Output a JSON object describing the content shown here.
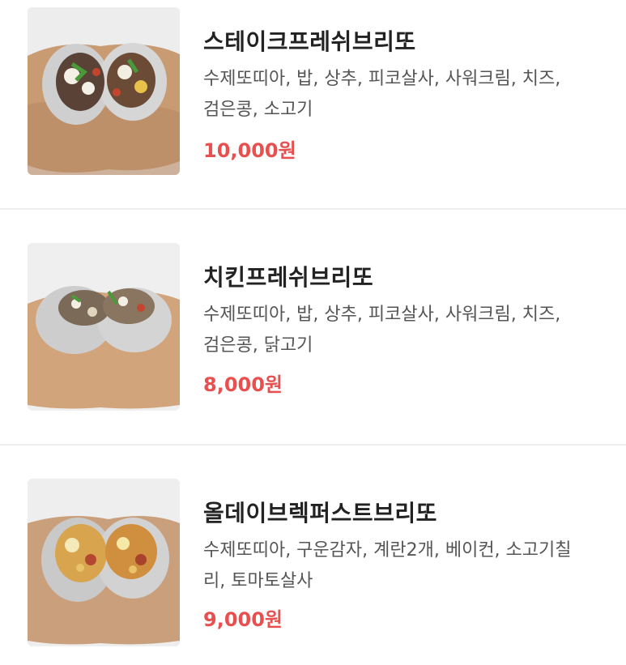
{
  "items": [
    {
      "name": "스테이크프레쉬브리또",
      "desc_line1": "수제또띠아, 밥, 상추, 피코살사, 사워크림, 치즈,",
      "desc_line2": "검은콩, 소고기",
      "price": "10,000원"
    },
    {
      "name": "치킨프레쉬브리또",
      "desc_line1": "수제또띠아, 밥, 상추, 피코살사, 사워크림, 치즈,",
      "desc_line2": "검은콩, 닭고기",
      "price": "8,000원"
    },
    {
      "name": "올데이브렉퍼스트브리또",
      "desc_line1": "수제또띠아, 구운감자, 계란2개, 베이컨, 소고기칠",
      "desc_line2": "리, 토마토살사",
      "price": "9,000원"
    }
  ],
  "colors": {
    "price": "#e8504f",
    "title": "#222222",
    "description": "#555555",
    "divider": "#eeeeee"
  }
}
